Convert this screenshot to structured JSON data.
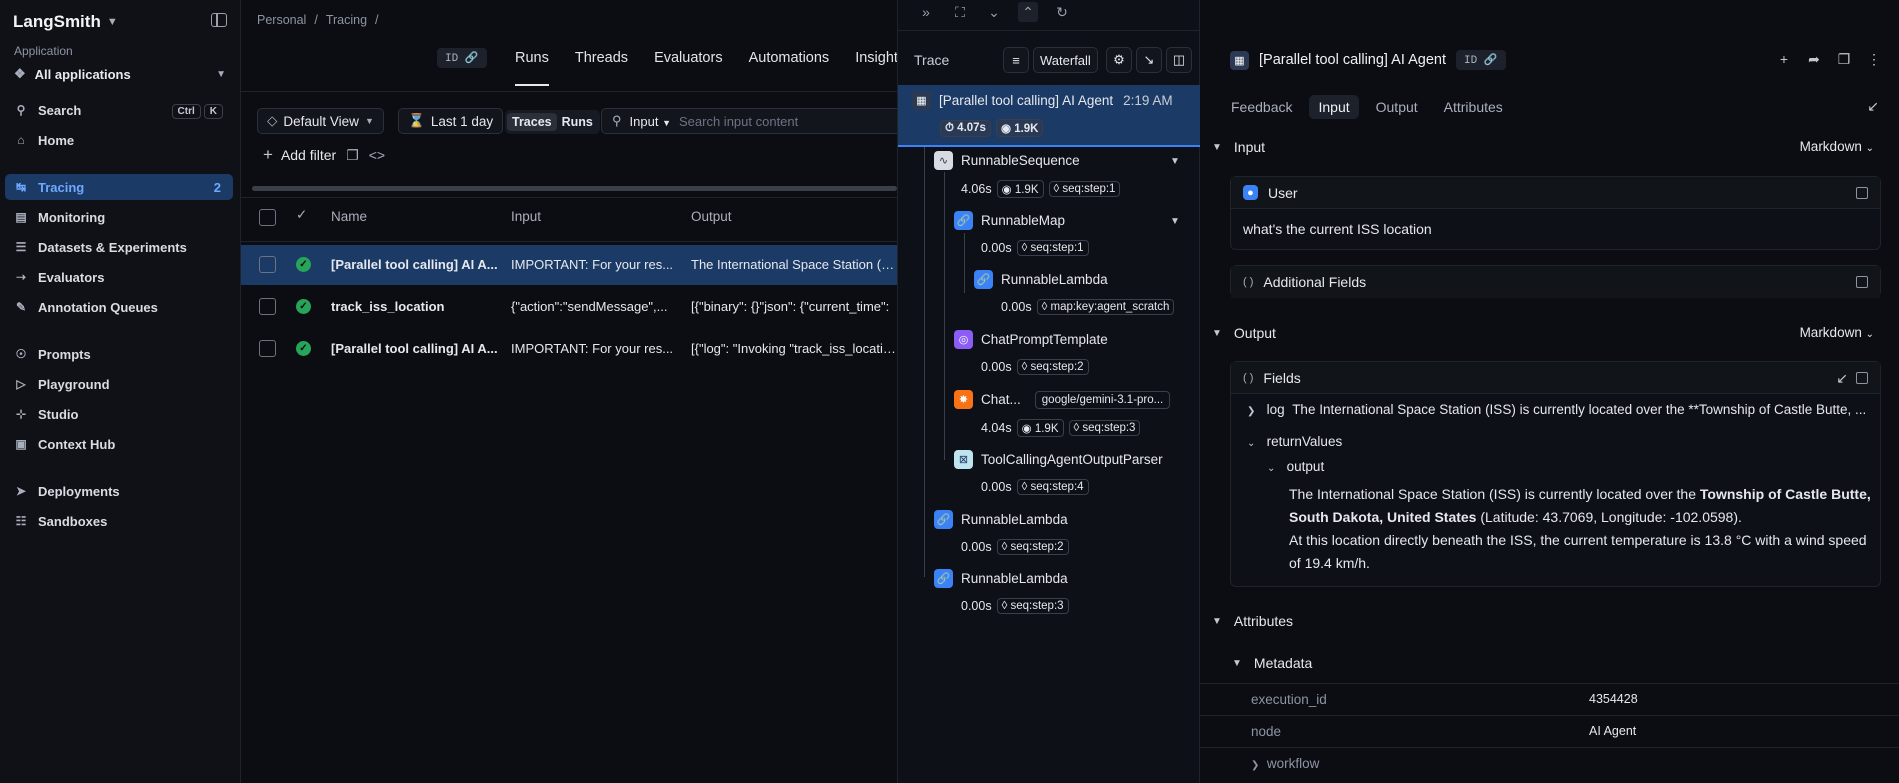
{
  "sidebar": {
    "brand": "LangSmith",
    "section_label": "Application",
    "app_selector": "All applications",
    "search": {
      "label": "Search",
      "k1": "Ctrl",
      "k2": "K"
    },
    "items": [
      {
        "label": "Home",
        "icon": "home-icon"
      },
      {
        "label": "Tracing",
        "icon": "tracing-icon",
        "count": "2"
      },
      {
        "label": "Monitoring",
        "icon": "monitoring-icon"
      },
      {
        "label": "Datasets & Experiments",
        "icon": "database-icon"
      },
      {
        "label": "Evaluators",
        "icon": "evaluators-icon"
      },
      {
        "label": "Annotation Queues",
        "icon": "pen-icon"
      },
      {
        "label": "Prompts",
        "icon": "prompts-icon"
      },
      {
        "label": "Playground",
        "icon": "playground-icon"
      },
      {
        "label": "Studio",
        "icon": "studio-icon"
      },
      {
        "label": "Context Hub",
        "icon": "box-icon"
      },
      {
        "label": "Deployments",
        "icon": "rocket-icon"
      },
      {
        "label": "Sandboxes",
        "icon": "sandbox-icon"
      }
    ]
  },
  "main": {
    "breadcrumb": [
      "Personal",
      "/",
      "Tracing",
      "/"
    ],
    "id_pill": "ID",
    "tabs": [
      "Runs",
      "Threads",
      "Evaluators",
      "Automations",
      "Insights"
    ],
    "view": "Default View",
    "range": "Last 1 day",
    "seg": [
      "Traces",
      "Runs"
    ],
    "search_field": "Input",
    "search_placeholder": "Search input content",
    "add_filter": "Add filter",
    "columns": [
      "Name",
      "Input",
      "Output"
    ],
    "rows": [
      {
        "name": "[Parallel tool calling] AI A...",
        "input": "IMPORTANT: For your res...",
        "output": "The International Space Station (ISS)"
      },
      {
        "name": "track_iss_location",
        "input": "{\"action\":\"sendMessage\",...",
        "output": "[{\"binary\": {}\"json\": {\"current_time\":"
      },
      {
        "name": "[Parallel tool calling] AI A...",
        "input": "IMPORTANT: For your res...",
        "output": "[{\"log\": \"Invoking \"track_iss_location"
      }
    ]
  },
  "trace": {
    "title": "Trace",
    "waterfall": "Waterfall",
    "root": {
      "name": "[Parallel tool calling] AI Agent",
      "time": "2:19 AM",
      "latency": "4.07s",
      "tokens": "1.9K"
    },
    "nodes": [
      {
        "name": "RunnableSequence",
        "lat": "4.06s",
        "tok": "1.9K",
        "tag": "seq:step:1"
      },
      {
        "name": "RunnableMap",
        "lat": "0.00s",
        "tag": "seq:step:1"
      },
      {
        "name": "RunnableLambda",
        "lat": "0.00s",
        "tag": "map:key:agent_scratch"
      },
      {
        "name": "ChatPromptTemplate",
        "lat": "0.00s",
        "tag": "seq:step:2"
      },
      {
        "name": "Chat...",
        "model": "google/gemini-3.1-pro...",
        "lat": "4.04s",
        "tok": "1.9K",
        "tag": "seq:step:3"
      },
      {
        "name": "ToolCallingAgentOutputParser",
        "lat": "0.00s",
        "tag": "seq:step:4"
      },
      {
        "name": "RunnableLambda",
        "lat": "0.00s",
        "tag": "seq:step:2"
      },
      {
        "name": "RunnableLambda",
        "lat": "0.00s",
        "tag": "seq:step:3"
      }
    ]
  },
  "detail": {
    "title": "[Parallel tool calling] AI Agent",
    "id": "ID",
    "tabs": [
      "Feedback",
      "Input",
      "Output",
      "Attributes"
    ],
    "input_header": "Input",
    "format": "Markdown",
    "user_label": "User",
    "user_msg": "what's the current ISS location",
    "additional": "Additional Fields",
    "output_header": "Output",
    "fields": "Fields",
    "log_key": "log",
    "log_val": "The International Space Station (ISS) is currently located over the **Township of Castle Butte, ...",
    "return_values": "returnValues",
    "output_key": "output",
    "out_p1a": "The International Space Station (ISS) is currently located over the ",
    "out_p1b": "Township of Castle Butte,",
    "out_p1c": "South Dakota, United States",
    "out_p1d": " (Latitude: 43.7069, Longitude: -102.0598).",
    "out_p2": "At this location directly beneath the ISS, the current temperature is 13.8 °C with a wind speed of 19.4 km/h.",
    "attributes_header": "Attributes",
    "metadata": "Metadata",
    "meta_rows": [
      {
        "k": "execution_id",
        "v": "4354428"
      },
      {
        "k": "node",
        "v": "AI Agent"
      }
    ],
    "workflow": "workflow"
  }
}
